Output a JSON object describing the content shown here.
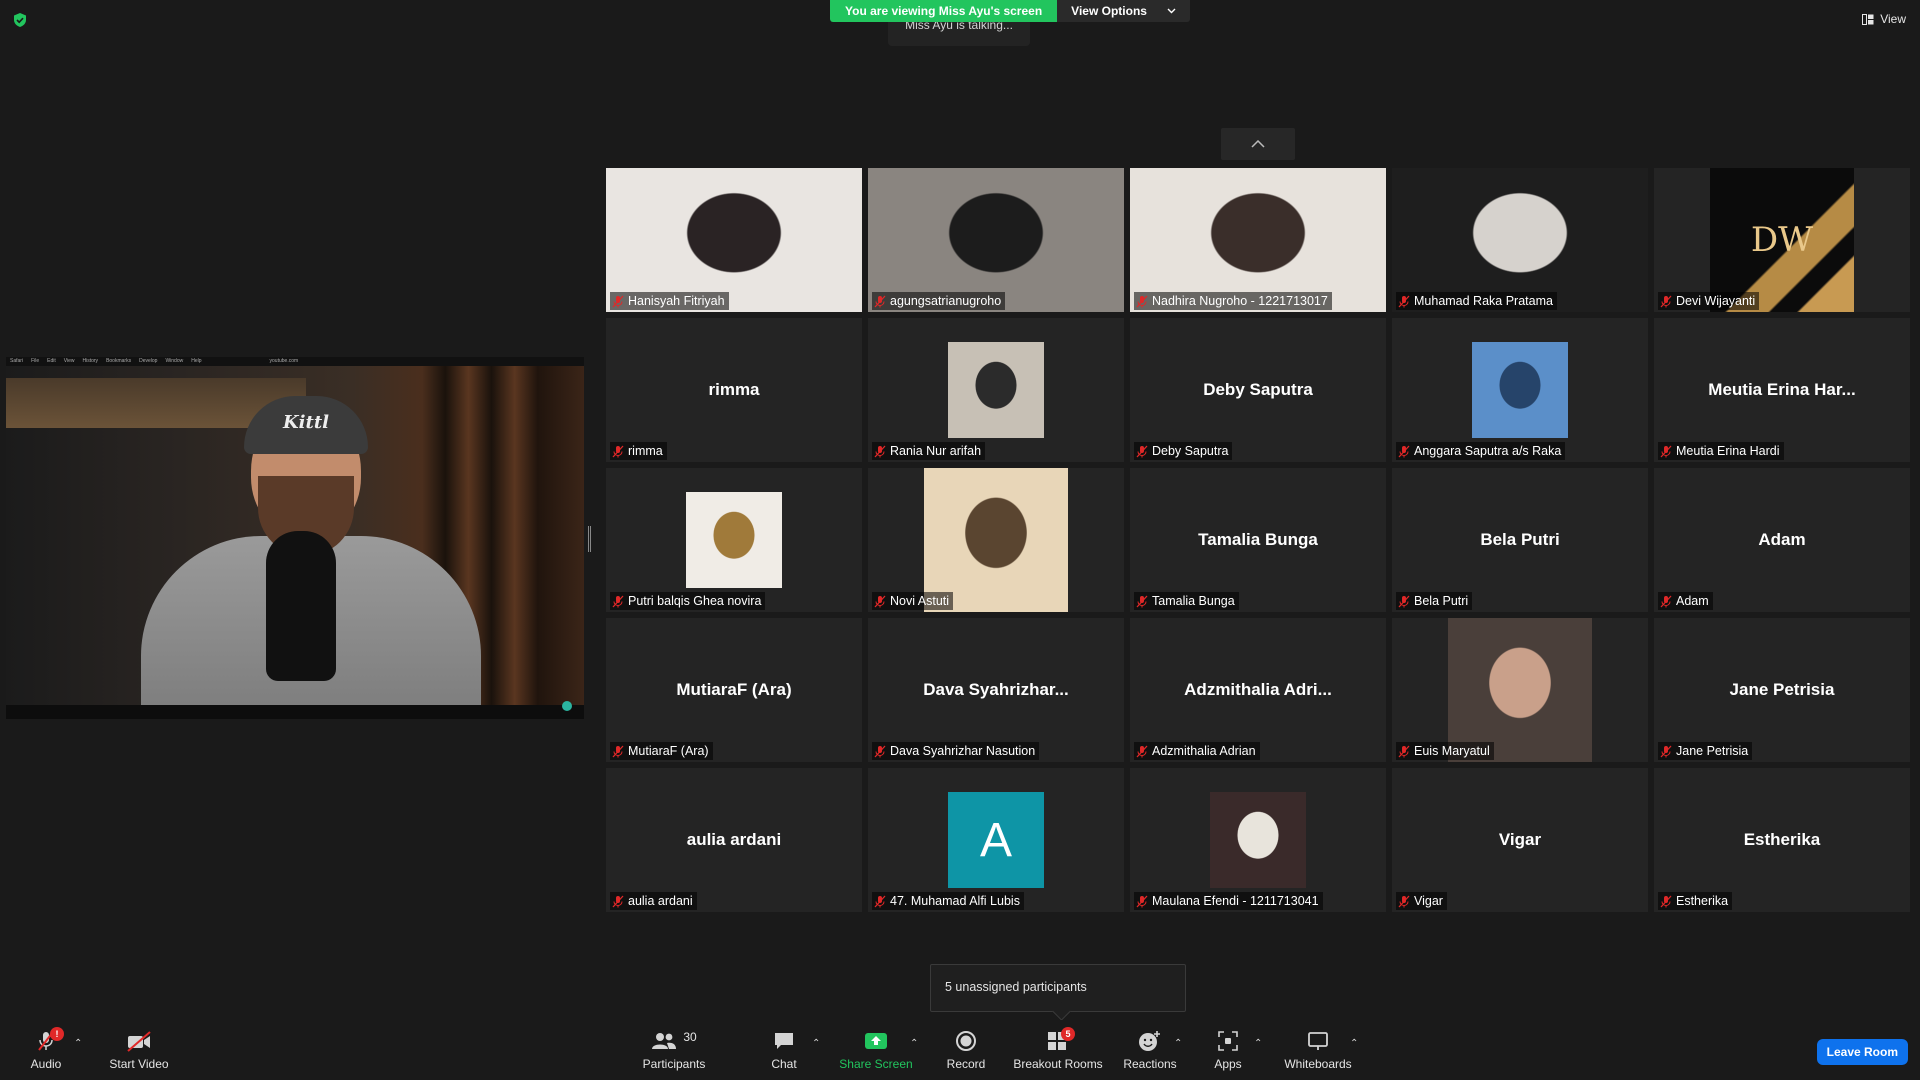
{
  "banner": {
    "viewing_text": "You are viewing Miss Ayu's screen",
    "view_options_label": "View Options",
    "talking_text": "Miss Ayu is talking..."
  },
  "top_right": {
    "view_label": "View"
  },
  "shared_screen": {
    "browser_menu": [
      "Safari",
      "File",
      "Edit",
      "View",
      "History",
      "Bookmarks",
      "Develop",
      "Window",
      "Help"
    ],
    "url_text": "youtube.com",
    "cap_text": "Kittl"
  },
  "participants_grid": [
    {
      "big": "",
      "label": "Hanisyah Fitriyah",
      "kind": "video",
      "colors": [
        "#e9e5e1",
        "#2a2324"
      ]
    },
    {
      "big": "",
      "label": "agungsatrianugroho",
      "kind": "video",
      "colors": [
        "#8a8580",
        "#1c1c1c"
      ]
    },
    {
      "big": "",
      "label": "Nadhira Nugroho - 1221713017",
      "kind": "video",
      "colors": [
        "#e7e2dc",
        "#3a2e2a"
      ]
    },
    {
      "big": "",
      "label": "Muhamad Raka Pratama",
      "kind": "video",
      "colors": [
        "#1e1e1e",
        "#d6d2cd"
      ]
    },
    {
      "big": "",
      "label": "Devi Wijayanti",
      "kind": "logo",
      "logo_text": "DW"
    },
    {
      "big": "rimma",
      "label": "rimma",
      "kind": "name"
    },
    {
      "big": "",
      "label": "Rania Nur arifah",
      "kind": "photo",
      "colors": [
        "#c7c0b5",
        "#2b2b2b"
      ]
    },
    {
      "big": "Deby Saputra",
      "label": "Deby Saputra",
      "kind": "name"
    },
    {
      "big": "",
      "label": "Anggara Saputra a/s Raka",
      "kind": "photo",
      "colors": [
        "#5b8fc9",
        "#26446a"
      ]
    },
    {
      "big": "Meutia Erina Har...",
      "label": "Meutia Erina Hardi",
      "kind": "name"
    },
    {
      "big": "",
      "label": "Putri balqis Ghea novira",
      "kind": "photo",
      "colors": [
        "#f0ece6",
        "#a07a3a"
      ]
    },
    {
      "big": "",
      "label": "Novi Astuti",
      "kind": "photo-tall",
      "colors": [
        "#e8d6b8",
        "#5a4530"
      ]
    },
    {
      "big": "Tamalia Bunga",
      "label": "Tamalia Bunga",
      "kind": "name"
    },
    {
      "big": "Bela Putri",
      "label": "Bela Putri",
      "kind": "name"
    },
    {
      "big": "Adam",
      "label": "Adam",
      "kind": "name"
    },
    {
      "big": "MutiaraF (Ara)",
      "label": "MutiaraF (Ara)",
      "kind": "name"
    },
    {
      "big": "Dava  Syahrizhar...",
      "label": "Dava Syahrizhar Nasution",
      "kind": "name"
    },
    {
      "big": "Adzmithalia  Adri...",
      "label": "Adzmithalia Adrian",
      "kind": "name"
    },
    {
      "big": "",
      "label": "Euis Maryatul",
      "kind": "photo-tall",
      "colors": [
        "#4a3f3a",
        "#c9a08a"
      ]
    },
    {
      "big": "Jane Petrisia",
      "label": "Jane Petrisia",
      "kind": "name"
    },
    {
      "big": "aulia ardani",
      "label": "aulia ardani",
      "kind": "name"
    },
    {
      "big": "",
      "label": "47. Muhamad Alfi Lubis",
      "kind": "letter",
      "letter": "A"
    },
    {
      "big": "",
      "label": "Maulana Efendi - 1211713041",
      "kind": "photo",
      "colors": [
        "#3a2a2a",
        "#e8e4dc"
      ]
    },
    {
      "big": "Vigar",
      "label": "Vigar",
      "kind": "name"
    },
    {
      "big": "Estherika",
      "label": "Estherika",
      "kind": "name"
    }
  ],
  "unassigned": {
    "text": "5 unassigned participants"
  },
  "toolbar": {
    "audio": "Audio",
    "audio_badge": "!",
    "start_video": "Start Video",
    "participants": "Participants",
    "participants_count": "30",
    "chat": "Chat",
    "share_screen": "Share Screen",
    "record": "Record",
    "breakout_rooms": "Breakout Rooms",
    "breakout_badge": "5",
    "reactions": "Reactions",
    "apps": "Apps",
    "whiteboards": "Whiteboards",
    "leave_room": "Leave Room"
  },
  "colors": {
    "accent_green": "#22c55e",
    "leave_blue": "#0e72ed",
    "mute_red": "#e02828",
    "avatar_teal": "#0e95a6"
  }
}
